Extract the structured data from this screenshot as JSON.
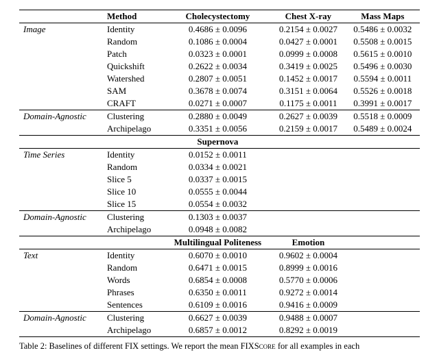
{
  "columns": {
    "method": "Method",
    "c1": "Cholecystectomy",
    "c2": "Chest X-ray",
    "c3": "Mass Maps",
    "supernova": "Supernova",
    "mp": "Multilingual Politeness",
    "emo": "Emotion"
  },
  "groups": {
    "image": "Image",
    "da": "Domain-Agnostic",
    "ts": "Time Series",
    "text": "Text"
  },
  "block1": {
    "image": [
      {
        "m": "Identity",
        "v": [
          "0.4686 ± 0.0096",
          "0.2154 ± 0.0027",
          "0.5486 ± 0.0032"
        ]
      },
      {
        "m": "Random",
        "v": [
          "0.1086 ± 0.0004",
          "0.0427 ± 0.0001",
          "0.5508 ± 0.0015"
        ]
      },
      {
        "m": "Patch",
        "v": [
          "0.0323 ± 0.0001",
          "0.0999 ± 0.0008",
          "0.5615 ± 0.0010"
        ]
      },
      {
        "m": "Quickshift",
        "v": [
          "0.2622 ± 0.0034",
          "0.3419 ± 0.0025",
          "0.5496 ± 0.0030"
        ]
      },
      {
        "m": "Watershed",
        "v": [
          "0.2807 ± 0.0051",
          "0.1452 ± 0.0017",
          "0.5594 ± 0.0011"
        ]
      },
      {
        "m": "SAM",
        "v": [
          "0.3678 ± 0.0074",
          "0.3151 ± 0.0064",
          "0.5526 ± 0.0018"
        ]
      },
      {
        "m": "CRAFT",
        "v": [
          "0.0271 ± 0.0007",
          "0.1175 ± 0.0011",
          "0.3991 ± 0.0017"
        ]
      }
    ],
    "da": [
      {
        "m": "Clustering",
        "v": [
          "0.2880 ± 0.0049",
          "0.2627 ± 0.0039",
          "0.5518 ± 0.0009"
        ]
      },
      {
        "m": "Archipelago",
        "v": [
          "0.3351 ± 0.0056",
          "0.2159 ± 0.0017",
          "0.5489 ± 0.0024"
        ]
      }
    ]
  },
  "block2": {
    "ts": [
      {
        "m": "Identity",
        "v": [
          "0.0152 ± 0.0011"
        ]
      },
      {
        "m": "Random",
        "v": [
          "0.0334 ± 0.0021"
        ]
      },
      {
        "m": "Slice 5",
        "v": [
          "0.0337 ± 0.0015"
        ]
      },
      {
        "m": "Slice 10",
        "v": [
          "0.0555 ± 0.0044"
        ]
      },
      {
        "m": "Slice 15",
        "v": [
          "0.0554 ± 0.0032"
        ]
      }
    ],
    "da": [
      {
        "m": "Clustering",
        "v": [
          "0.1303 ± 0.0037"
        ]
      },
      {
        "m": "Archipelago",
        "v": [
          "0.0948 ± 0.0082"
        ]
      }
    ]
  },
  "block3": {
    "text": [
      {
        "m": "Identity",
        "v": [
          "0.6070 ± 0.0010",
          "0.9602 ± 0.0004"
        ]
      },
      {
        "m": "Random",
        "v": [
          "0.6471 ± 0.0015",
          "0.8999 ± 0.0016"
        ]
      },
      {
        "m": "Words",
        "v": [
          "0.6854 ± 0.0008",
          "0.5770 ± 0.0006"
        ]
      },
      {
        "m": "Phrases",
        "v": [
          "0.6350 ± 0.0011",
          "0.9272 ± 0.0014"
        ]
      },
      {
        "m": "Sentences",
        "v": [
          "0.6109 ± 0.0016",
          "0.9416 ± 0.0009"
        ]
      }
    ],
    "da": [
      {
        "m": "Clustering",
        "v": [
          "0.6627 ± 0.0039",
          "0.9488 ± 0.0007"
        ]
      },
      {
        "m": "Archipelago",
        "v": [
          "0.6857 ± 0.0012",
          "0.8292 ± 0.0019"
        ]
      }
    ]
  },
  "caption": {
    "lead": "Table 2: Baselines of different FIX settings. We report the mean FIX",
    "sc": "Score",
    "tail": " for all examples in each"
  },
  "chart_data": {
    "type": "table",
    "title": "Table 2: Baselines of different FIX settings (mean FIXScore)",
    "sections": [
      {
        "datasets": [
          "Cholecystectomy",
          "Chest X-ray",
          "Mass Maps"
        ],
        "groups": [
          {
            "name": "Image",
            "rows": [
              {
                "method": "Identity",
                "mean": [
                  0.4686,
                  0.2154,
                  0.5486
                ],
                "std": [
                  0.0096,
                  0.0027,
                  0.0032
                ]
              },
              {
                "method": "Random",
                "mean": [
                  0.1086,
                  0.0427,
                  0.5508
                ],
                "std": [
                  0.0004,
                  0.0001,
                  0.0015
                ]
              },
              {
                "method": "Patch",
                "mean": [
                  0.0323,
                  0.0999,
                  0.5615
                ],
                "std": [
                  0.0001,
                  0.0008,
                  0.001
                ]
              },
              {
                "method": "Quickshift",
                "mean": [
                  0.2622,
                  0.3419,
                  0.5496
                ],
                "std": [
                  0.0034,
                  0.0025,
                  0.003
                ]
              },
              {
                "method": "Watershed",
                "mean": [
                  0.2807,
                  0.1452,
                  0.5594
                ],
                "std": [
                  0.0051,
                  0.0017,
                  0.0011
                ]
              },
              {
                "method": "SAM",
                "mean": [
                  0.3678,
                  0.3151,
                  0.5526
                ],
                "std": [
                  0.0074,
                  0.0064,
                  0.0018
                ]
              },
              {
                "method": "CRAFT",
                "mean": [
                  0.0271,
                  0.1175,
                  0.3991
                ],
                "std": [
                  0.0007,
                  0.0011,
                  0.0017
                ]
              }
            ]
          },
          {
            "name": "Domain-Agnostic",
            "rows": [
              {
                "method": "Clustering",
                "mean": [
                  0.288,
                  0.2627,
                  0.5518
                ],
                "std": [
                  0.0049,
                  0.0039,
                  0.0009
                ]
              },
              {
                "method": "Archipelago",
                "mean": [
                  0.3351,
                  0.2159,
                  0.5489
                ],
                "std": [
                  0.0056,
                  0.0017,
                  0.0024
                ]
              }
            ]
          }
        ]
      },
      {
        "datasets": [
          "Supernova"
        ],
        "groups": [
          {
            "name": "Time Series",
            "rows": [
              {
                "method": "Identity",
                "mean": [
                  0.0152
                ],
                "std": [
                  0.0011
                ]
              },
              {
                "method": "Random",
                "mean": [
                  0.0334
                ],
                "std": [
                  0.0021
                ]
              },
              {
                "method": "Slice 5",
                "mean": [
                  0.0337
                ],
                "std": [
                  0.0015
                ]
              },
              {
                "method": "Slice 10",
                "mean": [
                  0.0555
                ],
                "std": [
                  0.0044
                ]
              },
              {
                "method": "Slice 15",
                "mean": [
                  0.0554
                ],
                "std": [
                  0.0032
                ]
              }
            ]
          },
          {
            "name": "Domain-Agnostic",
            "rows": [
              {
                "method": "Clustering",
                "mean": [
                  0.1303
                ],
                "std": [
                  0.0037
                ]
              },
              {
                "method": "Archipelago",
                "mean": [
                  0.0948
                ],
                "std": [
                  0.0082
                ]
              }
            ]
          }
        ]
      },
      {
        "datasets": [
          "Multilingual Politeness",
          "Emotion"
        ],
        "groups": [
          {
            "name": "Text",
            "rows": [
              {
                "method": "Identity",
                "mean": [
                  0.607,
                  0.9602
                ],
                "std": [
                  0.001,
                  0.0004
                ]
              },
              {
                "method": "Random",
                "mean": [
                  0.6471,
                  0.8999
                ],
                "std": [
                  0.0015,
                  0.0016
                ]
              },
              {
                "method": "Words",
                "mean": [
                  0.6854,
                  0.577
                ],
                "std": [
                  0.0008,
                  0.0006
                ]
              },
              {
                "method": "Phrases",
                "mean": [
                  0.635,
                  0.9272
                ],
                "std": [
                  0.0011,
                  0.0014
                ]
              },
              {
                "method": "Sentences",
                "mean": [
                  0.6109,
                  0.9416
                ],
                "std": [
                  0.0016,
                  0.0009
                ]
              }
            ]
          },
          {
            "name": "Domain-Agnostic",
            "rows": [
              {
                "method": "Clustering",
                "mean": [
                  0.6627,
                  0.9488
                ],
                "std": [
                  0.0039,
                  0.0007
                ]
              },
              {
                "method": "Archipelago",
                "mean": [
                  0.6857,
                  0.8292
                ],
                "std": [
                  0.0012,
                  0.0019
                ]
              }
            ]
          }
        ]
      }
    ]
  }
}
